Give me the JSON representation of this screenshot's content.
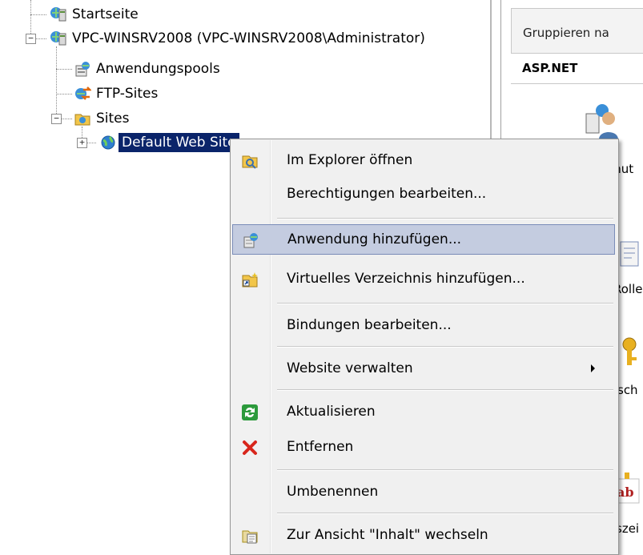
{
  "tree": {
    "items": [
      {
        "label": "Startseite"
      },
      {
        "label": "VPC-WINSRV2008 (VPC-WINSRV2008\\Administrator)"
      },
      {
        "label": "Anwendungspools"
      },
      {
        "label": "FTP-Sites"
      },
      {
        "label": "Sites"
      },
      {
        "label": "Default Web Site"
      }
    ]
  },
  "right_pane": {
    "group_label": "Gruppieren na",
    "section_header": "ASP.NET",
    "feature_labels": [
      "enut",
      "Rolle",
      "sch",
      "szei"
    ]
  },
  "context_menu": {
    "items": [
      {
        "label": "Im Explorer öffnen",
        "icon": "explorer-icon"
      },
      {
        "label": "Berechtigungen bearbeiten...",
        "icon": ""
      },
      {
        "label": "Anwendung hinzufügen...",
        "icon": "add-application-icon"
      },
      {
        "label": "Virtuelles Verzeichnis hinzufügen...",
        "icon": "add-virtual-directory-icon"
      },
      {
        "label": "Bindungen bearbeiten...",
        "icon": ""
      },
      {
        "label": "Website verwalten",
        "icon": "",
        "submenu": true
      },
      {
        "label": "Aktualisieren",
        "icon": "refresh-icon"
      },
      {
        "label": "Entfernen",
        "icon": "delete-icon"
      },
      {
        "label": "Umbenennen",
        "icon": ""
      },
      {
        "label": "Zur Ansicht \"Inhalt\" wechseln",
        "icon": "content-view-icon"
      }
    ],
    "highlighted_item": "Anwendung hinzufügen..."
  },
  "colors": {
    "selection": "#0a246a",
    "menu_highlight": "#c4cce0",
    "delete_red": "#d8261c",
    "refresh_green": "#2c9a3c"
  }
}
